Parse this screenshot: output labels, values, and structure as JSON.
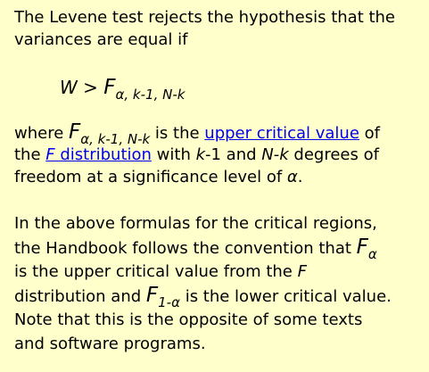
{
  "intro": {
    "line1": "The Levene test rejects the hypothesis that the",
    "line2": "variances are equal if"
  },
  "formula": {
    "lhs": "W",
    "op": " > ",
    "F": "F",
    "sub": "α, k-1, N-k"
  },
  "where_para": {
    "word_where": "where ",
    "F": "F",
    "sub": "α, k-1, N-k",
    "is_the": " is the ",
    "link_upper": "upper critical value",
    "of": " of",
    "the": "the ",
    "link_F_italic": "F",
    "link_dist": " distribution",
    "with": " with ",
    "k": "k",
    "minus1_and": "-1 and ",
    "N": "N",
    "dash": "-",
    "k2": "k",
    "degrees_of": " degrees of",
    "line3_prefix": "freedom at a significance level of ",
    "alpha": "α",
    "period": "."
  },
  "convention_para": {
    "l1": "In the above formulas for the critical regions,",
    "l2_text": "the Handbook follows the convention that ",
    "l2_F": "F",
    "l2_sub": "α",
    "l3_text": "is the upper critical value from the ",
    "l3_F": "F",
    "l4_text": "distribution and ",
    "l4_F": "F",
    "l4_sub": "1-α",
    "l4_rest": " is the lower critical value.",
    "l5": "Note that this is the opposite of some texts",
    "l6": "and software programs."
  }
}
